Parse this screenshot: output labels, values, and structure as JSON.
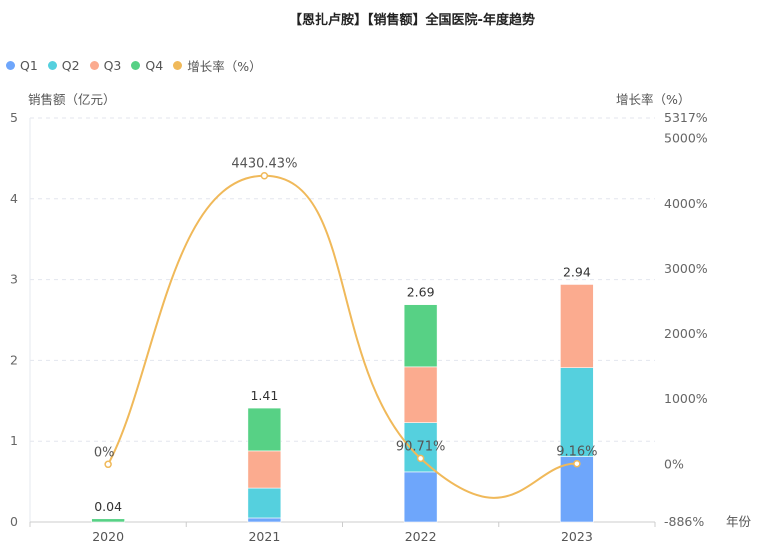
{
  "chart_data": {
    "type": "bar",
    "title": "【恩扎卢胺】【销售额】全国医院-年度趋势",
    "xlabel": "年份",
    "ylabel": "销售额（亿元）",
    "y2label": "增长率（%）",
    "categories": [
      "2020",
      "2021",
      "2022",
      "2023"
    ],
    "ylim": [
      0,
      5
    ],
    "yticks": [
      "0",
      "1",
      "2",
      "3",
      "4",
      "5"
    ],
    "y2lim": [
      -886,
      5317
    ],
    "y2ticks": [
      "-886%",
      "0%",
      "1000%",
      "2000%",
      "3000%",
      "4000%",
      "5000%",
      "5317%"
    ],
    "y2tick_values": [
      -886,
      0,
      1000,
      2000,
      3000,
      4000,
      5000,
      5317
    ],
    "series": [
      {
        "name": "Q1",
        "color": "#6ea6fb",
        "values": [
          0,
          0.05,
          0.62,
          0.81
        ]
      },
      {
        "name": "Q2",
        "color": "#55d0de",
        "values": [
          0,
          0.37,
          0.61,
          1.1
        ]
      },
      {
        "name": "Q3",
        "color": "#fbab8f",
        "values": [
          0,
          0.46,
          0.69,
          1.03
        ]
      },
      {
        "name": "Q4",
        "color": "#57d185",
        "values": [
          0.04,
          0.53,
          0.77,
          0
        ]
      }
    ],
    "totals": [
      "0.04",
      "1.41",
      "2.69",
      "2.94"
    ],
    "total_values": [
      0.04,
      1.41,
      2.69,
      2.94
    ],
    "line": {
      "name": "增长率（%）",
      "color": "#f0b95a",
      "values": [
        0,
        4430.43,
        90.71,
        9.16
      ],
      "labels": [
        "0%",
        "4430.43%",
        "90.71%",
        "9.16%"
      ]
    },
    "legend_position": "top-left",
    "grid": true
  }
}
